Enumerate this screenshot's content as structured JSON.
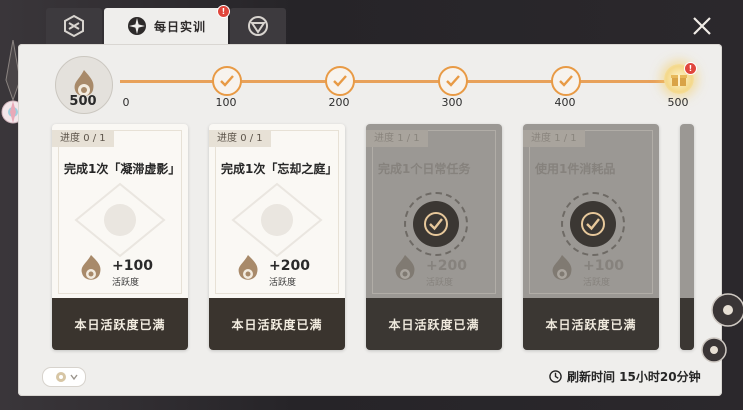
{
  "tabs": [
    {
      "icon": "cube-icon"
    },
    {
      "icon": "compass-icon",
      "label": "每日实训",
      "badge": "!"
    },
    {
      "icon": "triangle-ring-icon"
    }
  ],
  "progress": {
    "total_label": "500",
    "start_label": "0",
    "milestones": [
      {
        "label": "100",
        "state": "claimed"
      },
      {
        "label": "200",
        "state": "claimed"
      },
      {
        "label": "300",
        "state": "claimed"
      },
      {
        "label": "400",
        "state": "claimed"
      },
      {
        "label": "500",
        "state": "gift",
        "badge": "!"
      }
    ]
  },
  "cards": [
    {
      "progress_label": "进度",
      "progress_value": "0 / 1",
      "title": "完成1次「凝滞虚影」",
      "reward": "+100",
      "reward_unit": "活跃度",
      "button": "本日活跃度已满",
      "done": false
    },
    {
      "progress_label": "进度",
      "progress_value": "0 / 1",
      "title": "完成1次「忘却之庭」",
      "reward": "+200",
      "reward_unit": "活跃度",
      "button": "本日活跃度已满",
      "done": false
    },
    {
      "progress_label": "进度",
      "progress_value": "1 / 1",
      "title": "完成1个日常任务",
      "reward": "+200",
      "reward_unit": "活跃度",
      "button": "本日活跃度已满",
      "done": true
    },
    {
      "progress_label": "进度",
      "progress_value": "1 / 1",
      "title": "使用1件消耗品",
      "reward": "+100",
      "reward_unit": "活跃度",
      "button": "本日活跃度已满",
      "done": true
    }
  ],
  "refresh": {
    "icon": "clock-icon",
    "label": "刷新时间 15小时20分钟"
  },
  "colors": {
    "accent": "#e8a15a",
    "badge": "#e0463c",
    "panel": "#efeeec",
    "button": "#3a342e"
  }
}
